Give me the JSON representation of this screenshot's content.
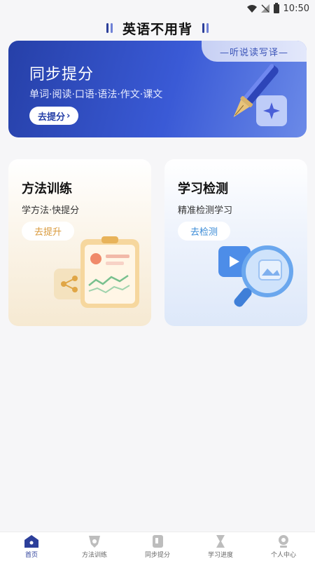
{
  "status_bar": {
    "time": "10:50"
  },
  "header": {
    "title": "英语不用背"
  },
  "banner": {
    "tag": "—听说读写译—",
    "title": "同步提分",
    "subtitle": "单词·阅读·口语·语法·作文·课文",
    "button": "去提分",
    "button_arrow": "›"
  },
  "cards": [
    {
      "title": "方法训练",
      "subtitle": "学方法·快提分",
      "button": "去提升"
    },
    {
      "title": "学习检测",
      "subtitle": "精准检测学习",
      "button": "去检测"
    }
  ],
  "nav": {
    "items": [
      {
        "label": "首页",
        "icon": "home-icon",
        "active": true
      },
      {
        "label": "方法训练",
        "icon": "method-icon",
        "active": false
      },
      {
        "label": "同步提分",
        "icon": "book-icon",
        "active": false
      },
      {
        "label": "学习进度",
        "icon": "hourglass-icon",
        "active": false
      },
      {
        "label": "个人中心",
        "icon": "profile-icon",
        "active": false
      }
    ]
  },
  "colors": {
    "accent": "#2c3f9a",
    "banner": "#3a5ad6",
    "left_card_button": "#d99a3c",
    "right_card_button": "#3a8bd6"
  }
}
